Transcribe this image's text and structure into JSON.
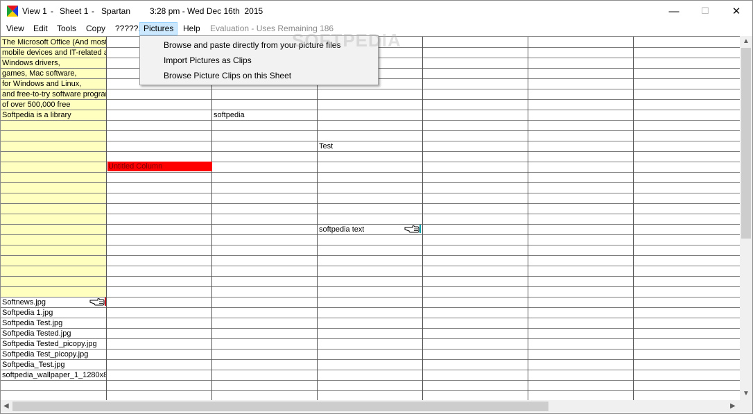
{
  "titlebar": {
    "view": "View 1",
    "sep1": "-",
    "sheet": "Sheet 1",
    "sep2": "-",
    "app": "Spartan",
    "time": "3:28 pm - Wed Dec 16th  2015",
    "minimize": "—",
    "maximize": "☐",
    "close": "✕"
  },
  "menubar": {
    "items": [
      "View",
      "Edit",
      "Tools",
      "Copy",
      "?????.",
      "Pictures",
      "Help"
    ],
    "evaluation": "Evaluation - Uses Remaining 186"
  },
  "pictures_menu": {
    "items": [
      "Browse and paste directly from your picture files",
      "Import Pictures as Clips",
      "Browse Picture Clips on this Sheet"
    ]
  },
  "watermark": "SOFTPEDIA",
  "sheet": {
    "col1_text": [
      "The Microsoft Office (And most",
      "mobile devices and IT-related ar",
      "Windows drivers,",
      "games, Mac software,",
      "for Windows and Linux,",
      "and free-to-try software program",
      "of over 500,000 free",
      "Softpedia is a library"
    ],
    "col2_red_cell": "Untitled Column",
    "col3_text": "softpedia",
    "col4_test": "Test",
    "col4_softpedia_text": "softpedia text",
    "col1_files": [
      "Softnews.jpg",
      "Softpedia 1.jpg",
      "Softpedia Test.jpg",
      "Softpedia Tested.jpg",
      "Softpedia Tested_picopy.jpg",
      "Softpedia Test_picopy.jpg",
      "Softpedia_Test.jpg",
      "softpedia_wallpaper_1_1280x8"
    ]
  },
  "colors": {
    "yellow_fill": "#ffffc0",
    "red_fill": "#ff0000",
    "menu_highlight": "#cce8ff"
  }
}
